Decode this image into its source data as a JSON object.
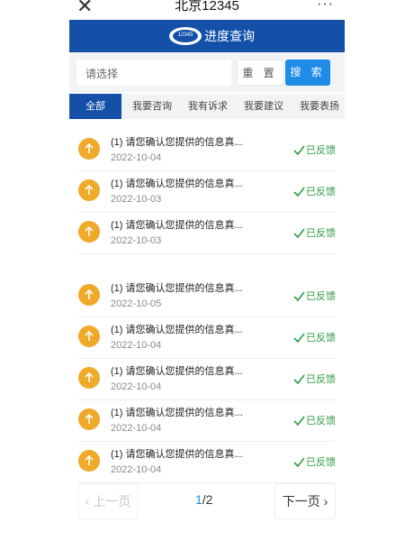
{
  "app": {
    "title": "北京12345",
    "close_glyph": "✕",
    "more_glyph": "···"
  },
  "header": {
    "logo_text": "12345",
    "title": "进度查询"
  },
  "search": {
    "placeholder": "请选择",
    "reset_label": "重 置",
    "search_label": "搜 索"
  },
  "tabs": [
    {
      "label": "全部",
      "active": true
    },
    {
      "label": "我要咨询",
      "active": false
    },
    {
      "label": "我有诉求",
      "active": false
    },
    {
      "label": "我要建议",
      "active": false
    },
    {
      "label": "我要表扬",
      "active": false
    }
  ],
  "items": [
    {
      "title": "(1) 请您确认您提供的信息真...",
      "date": "2022-10-04",
      "status": "已反馈"
    },
    {
      "title": "(1) 请您确认您提供的信息真...",
      "date": "2022-10-03",
      "status": "已反馈"
    },
    {
      "title": "(1) 请您确认您提供的信息真...",
      "date": "2022-10-03",
      "status": "已反馈"
    },
    {
      "title": "(1) 请您确认您提供的信息真...",
      "date": "2022-10-05",
      "status": "已反馈"
    },
    {
      "title": "(1) 请您确认您提供的信息真...",
      "date": "2022-10-04",
      "status": "已反馈"
    },
    {
      "title": "(1) 请您确认您提供的信息真...",
      "date": "2022-10-04",
      "status": "已反馈"
    },
    {
      "title": "(1) 请您确认您提供的信息真...",
      "date": "2022-10-04",
      "status": "已反馈"
    },
    {
      "title": "(1) 请您确认您提供的信息真...",
      "date": "2022-10-04",
      "status": "已反馈"
    }
  ],
  "pagination": {
    "prev_label": "‹ 上一页",
    "current": "1",
    "total": "/2",
    "next_label": "下一页 ›"
  },
  "colors": {
    "header_blue": "#1450a8",
    "search_blue": "#1e8be6",
    "status_green": "#2e9a43",
    "icon_orange": "#f0a928"
  },
  "icons": {
    "close": "close-icon",
    "more": "more-icon",
    "logo": "logo-icon",
    "item": "arrow-up-icon",
    "status": "check-icon"
  }
}
